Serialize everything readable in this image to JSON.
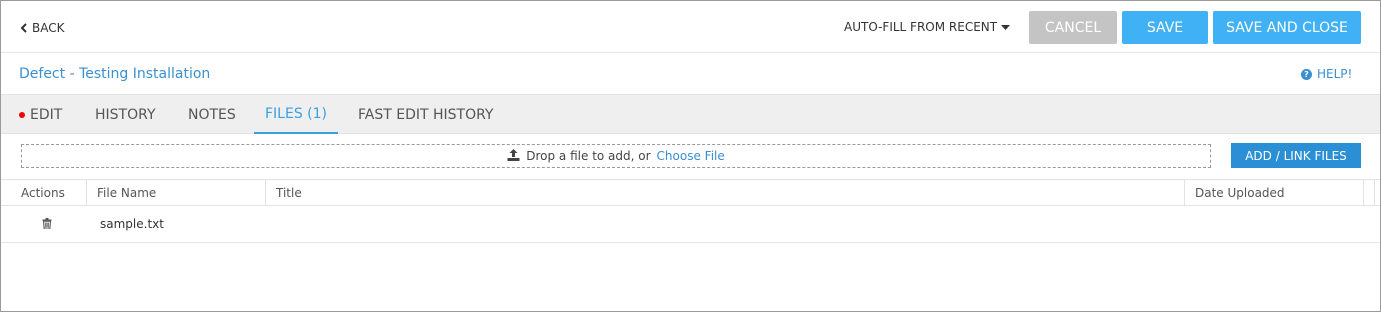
{
  "header": {
    "back_label": "BACK",
    "autofill_label": "AUTO-FILL FROM RECENT",
    "cancel_label": "CANCEL",
    "save_label": "SAVE",
    "save_close_label": "SAVE AND CLOSE"
  },
  "title_row": {
    "title": "Defect - Testing Installation",
    "help_label": "HELP!"
  },
  "tabs": [
    {
      "label": "EDIT",
      "has_dot": true
    },
    {
      "label": "HISTORY"
    },
    {
      "label": "NOTES"
    },
    {
      "label": "FILES (1)",
      "active": true
    },
    {
      "label": "FAST EDIT HISTORY"
    }
  ],
  "upload": {
    "drop_text": "Drop a file to add, or",
    "choose_label": "Choose File",
    "add_link_label": "ADD / LINK FILES"
  },
  "table": {
    "columns": [
      "Actions",
      "File Name",
      "Title",
      "Date Uploaded"
    ],
    "rows": [
      {
        "file_name": "sample.txt",
        "title": "",
        "date_uploaded": ""
      }
    ]
  },
  "colors": {
    "accent": "#3fb1f4",
    "link": "#3a8fd0",
    "cancel": "#c4c4c4",
    "add_button": "#2a8fd4",
    "dot": "#ee0000"
  }
}
